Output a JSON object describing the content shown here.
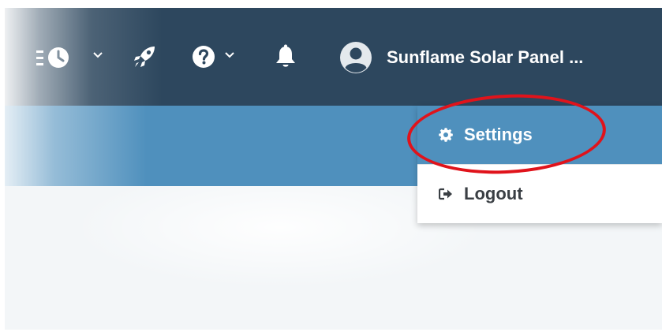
{
  "header": {
    "user_name": "Sunflame Solar Panel ...",
    "icons": [
      "menu-clock-icon",
      "chevron-down-icon",
      "rocket-icon",
      "help-icon",
      "chevron-down-icon",
      "bell-icon",
      "user-avatar-icon"
    ]
  },
  "user_menu": {
    "items": [
      {
        "label": "Settings",
        "icon": "gear-icon"
      },
      {
        "label": "Logout",
        "icon": "logout-icon"
      }
    ]
  },
  "colors": {
    "topbar": "#2d475e",
    "subbar": "#4f90bd",
    "menu_highlight": "#4f90bd",
    "annotation_ring": "#e0131b"
  }
}
